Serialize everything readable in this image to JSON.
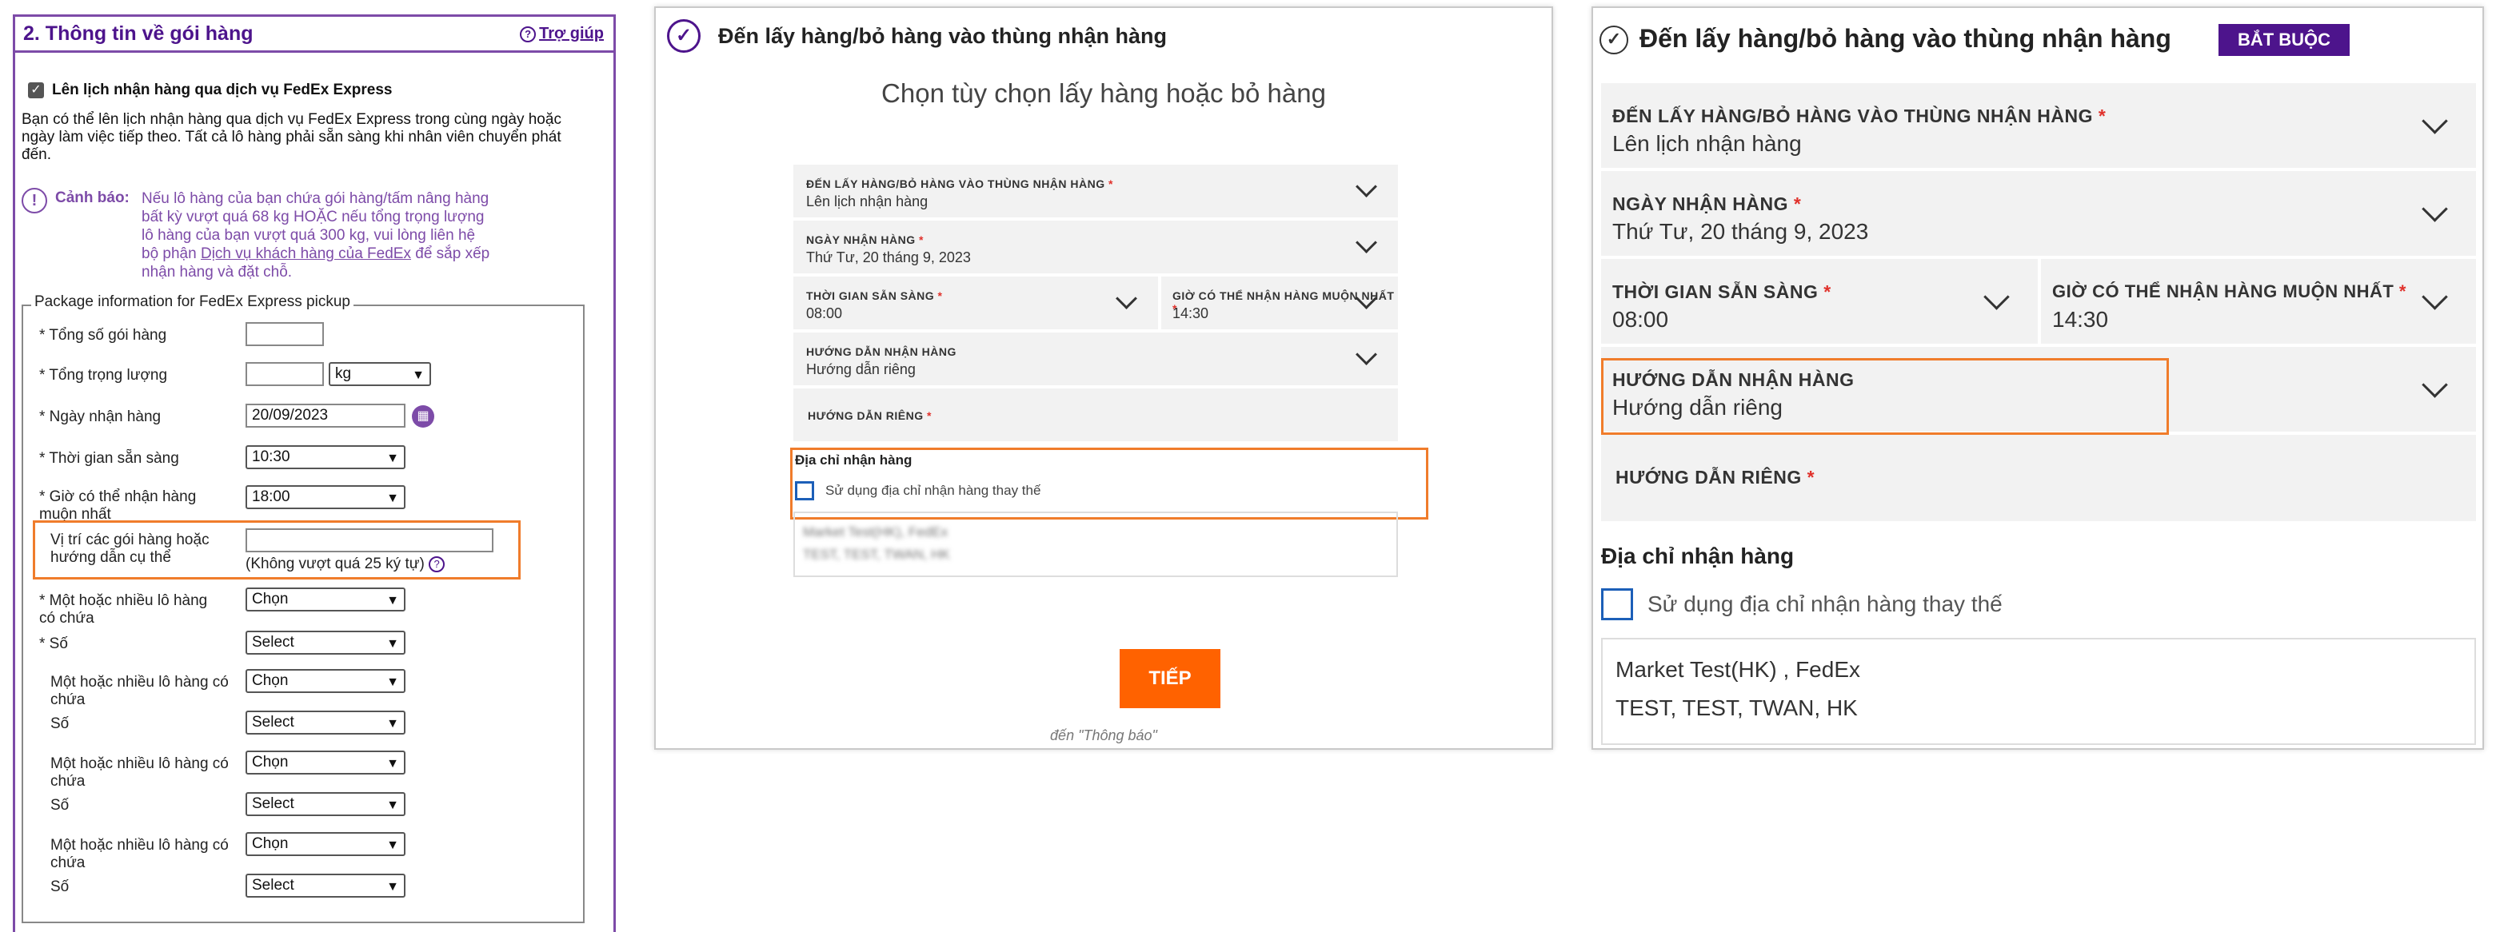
{
  "panel1": {
    "title": "2. Thông tin về gói hàng",
    "help": "Trợ giúp",
    "schedule_label": "Lên lịch nhận hàng qua dịch vụ FedEx Express",
    "description": "Bạn có thể lên lịch nhận hàng qua dịch vụ FedEx Express trong cùng ngày hoặc ngày làm việc tiếp theo. Tất cả lô hàng phải sẵn sàng khi nhân viên chuyển phát đến.",
    "warning_label": "Cảnh báo:",
    "warning_text_1": "Nếu lô hàng của bạn chứa gói hàng/tấm nâng hàng bất kỳ vượt quá 68 kg HOẶC nếu tổng trọng lượng lô hàng của bạn vượt quá 300 kg, vui lòng liên hệ bộ phận",
    "warning_link": "Dịch vụ khách hàng của FedEx",
    "warning_text_2": "để sắp xếp nhận hàng và đặt chỗ.",
    "fieldset_legend": "Package information for FedEx Express pickup",
    "total_packages_label": "* Tổng số gói hàng",
    "total_weight_label": "* Tổng trọng lượng",
    "weight_unit": "kg",
    "pickup_date_label": "* Ngày nhận hàng",
    "pickup_date": "20/09/2023",
    "ready_time_label": "* Thời gian sẵn sàng",
    "ready_time": "10:30",
    "latest_time_label": "* Giờ có thể nhận hàng muộn nhất",
    "latest_time": "18:00",
    "location_label": "Vị trí các gói hàng hoặc hướng dẫn cụ thể",
    "location_hint": "(Không vượt quá 25 ký tự)",
    "contains_label_req": "* Một hoặc nhiều lô hàng có chứa",
    "number_label_req": "* Số",
    "contains_label": "Một hoặc nhiều lô hàng có chứa",
    "number_label": "Số",
    "choose": "Chọn",
    "select": "Select"
  },
  "panel2": {
    "header": "Đến lấy hàng/bỏ hàng vào thùng nhận hàng",
    "subtitle": "Chọn tùy chọn lấy hàng hoặc bỏ hàng",
    "dropoff_label": "ĐẾN LẤY HÀNG/BỎ HÀNG VÀO THÙNG NHẬN HÀNG",
    "dropoff_value": "Lên lịch nhận hàng",
    "date_label": "NGÀY NHẬN HÀNG",
    "date_value": "Thứ Tư, 20 tháng 9, 2023",
    "ready_label": "THỜI GIAN SẴN SÀNG",
    "ready_value": "08:00",
    "latest_label": "GIỜ CÓ THỂ NHẬN HÀNG MUỘN NHẤT",
    "latest_value": "14:30",
    "instr_label": "HƯỚNG DẪN NHẬN HÀNG",
    "instr_value": "Hướng dẫn riêng",
    "special_label": "HƯỚNG DẪN RIÊNG",
    "address_title": "Địa chỉ nhận hàng",
    "alt_address": "Sử dụng địa chỉ nhận hàng thay thế",
    "address_line1": "Market Test(HK), FedEx",
    "address_line2": "TEST, TEST, TWAN, HK",
    "next_button": "TIẾP",
    "next_hint": "đến \"Thông báo\""
  },
  "panel3": {
    "header": "Đến lấy hàng/bỏ hàng vào thùng nhận hàng",
    "badge": "BẮT BUỘC",
    "dropoff_label": "ĐẾN LẤY HÀNG/BỎ HÀNG VÀO THÙNG NHẬN HÀNG",
    "dropoff_value": "Lên lịch nhận hàng",
    "date_label": "NGÀY NHẬN HÀNG",
    "date_value": "Thứ Tư, 20 tháng 9, 2023",
    "ready_label": "THỜI GIAN SẴN SÀNG",
    "ready_value": "08:00",
    "latest_label": "GIỜ CÓ THỂ NHẬN HÀNG MUỘN NHẤT",
    "latest_value": "14:30",
    "instr_label": "HƯỚNG DẪN NHẬN HÀNG",
    "instr_value": "Hướng dẫn riêng",
    "special_label": "HƯỚNG DẪN RIÊNG",
    "address_title": "Địa chỉ nhận hàng",
    "alt_address": "Sử dụng địa chỉ nhận hàng thay thế",
    "address_line1": "Market Test(HK) , FedEx",
    "address_line2": "TEST, TEST, TWAN, HK"
  },
  "colors": {
    "fedex_purple": "#4d148c",
    "fedex_orange": "#ff6200",
    "highlight": "#f07c2b",
    "required": "#e0312b"
  }
}
